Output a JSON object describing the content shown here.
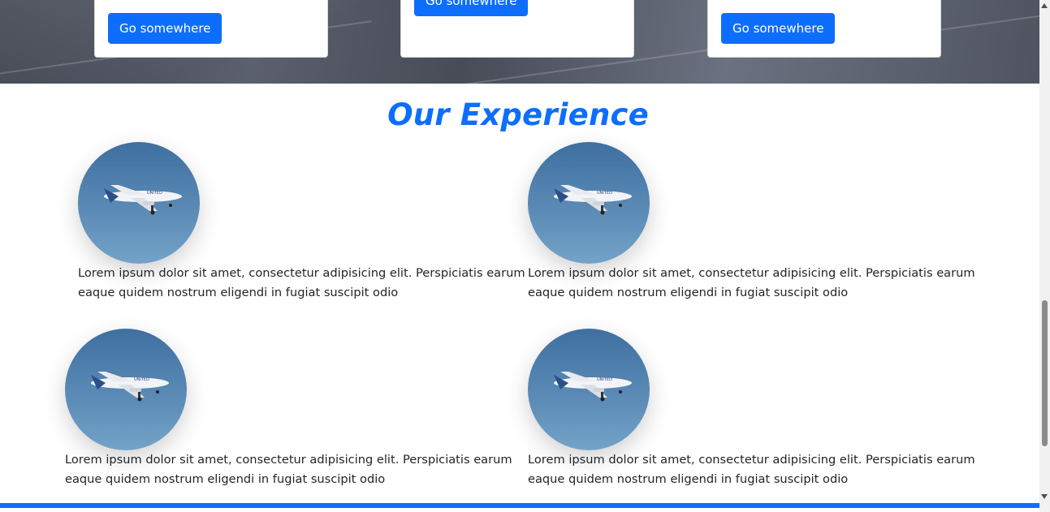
{
  "cards": [
    {
      "button_label": "Go somewhere"
    },
    {
      "button_label": "Go somewhere"
    },
    {
      "button_label": "Go somewhere"
    }
  ],
  "experience": {
    "title": "Our Experience",
    "items": [
      {
        "text": "Lorem ipsum dolor sit amet, consectetur adipisicing elit. Perspiciatis earum eaque quidem nostrum eligendi in fugiat suscipit odio"
      },
      {
        "text": "Lorem ipsum dolor sit amet, consectetur adipisicing elit. Perspiciatis earum eaque quidem nostrum eligendi in fugiat suscipit odio"
      },
      {
        "text": "Lorem ipsum dolor sit amet, consectetur adipisicing elit. Perspiciatis earum eaque quidem nostrum eligendi in fugiat suscipit odio"
      },
      {
        "text": "Lorem ipsum dolor sit amet, consectetur adipisicing elit. Perspiciatis earum eaque quidem nostrum eligendi in fugiat suscipit odio"
      }
    ],
    "image_icon": "airplane-icon",
    "airline_logo_text": "UNITED"
  },
  "colors": {
    "primary": "#0d6efd",
    "text": "#212529",
    "sky": "#5a8ab5"
  }
}
